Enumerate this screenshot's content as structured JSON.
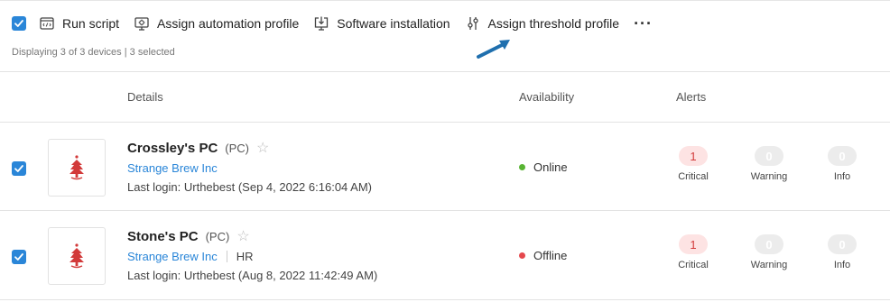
{
  "toolbar": {
    "run_script": "Run script",
    "assign_automation": "Assign automation profile",
    "software_installation": "Software installation",
    "assign_threshold": "Assign threshold profile",
    "more": "···"
  },
  "status_text": "Displaying 3 of 3 devices | 3 selected",
  "columns": {
    "details": "Details",
    "availability": "Availability",
    "alerts": "Alerts"
  },
  "colors": {
    "accent": "#2a86d8",
    "online": "#58b433",
    "offline": "#e5484d",
    "critical": "#d23a3a"
  },
  "devices": [
    {
      "name": "Crossley's PC",
      "type": "(PC)",
      "organization": "Strange Brew Inc",
      "group": "",
      "last_login": "Last login: Urthebest (Sep 4, 2022 6:16:04 AM)",
      "availability": "Online",
      "selected": true,
      "alerts": {
        "critical_count": "1",
        "critical_label": "Critical",
        "warning_count": "0",
        "warning_label": "Warning",
        "info_count": "0",
        "info_label": "Info"
      }
    },
    {
      "name": "Stone's PC",
      "type": "(PC)",
      "organization": "Strange Brew Inc",
      "group": "HR",
      "last_login": "Last login: Urthebest (Aug 8, 2022 11:42:49 AM)",
      "availability": "Offline",
      "selected": true,
      "alerts": {
        "critical_count": "1",
        "critical_label": "Critical",
        "warning_count": "0",
        "warning_label": "Warning",
        "info_count": "0",
        "info_label": "Info"
      }
    }
  ]
}
